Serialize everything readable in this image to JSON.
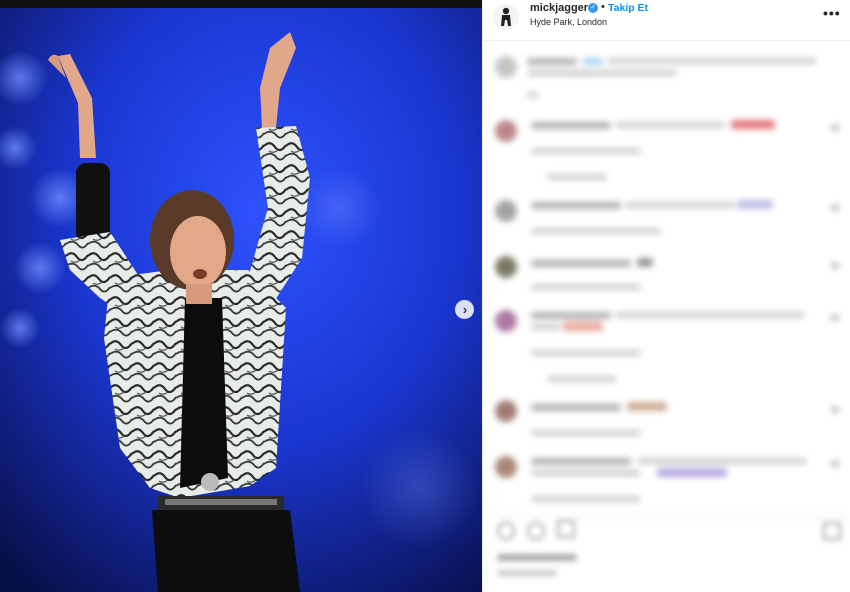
{
  "post": {
    "username": "mickjagger",
    "separator": "•",
    "follow_label": "Takip Et",
    "location": "Hyde Park, London",
    "more_label": "•••",
    "verified_icon": "verified-badge-icon",
    "next_icon": "›"
  },
  "colors": {
    "accent": "#0095f6",
    "stage_blue": "#1530c8",
    "stage_dark": "#0a1450"
  }
}
